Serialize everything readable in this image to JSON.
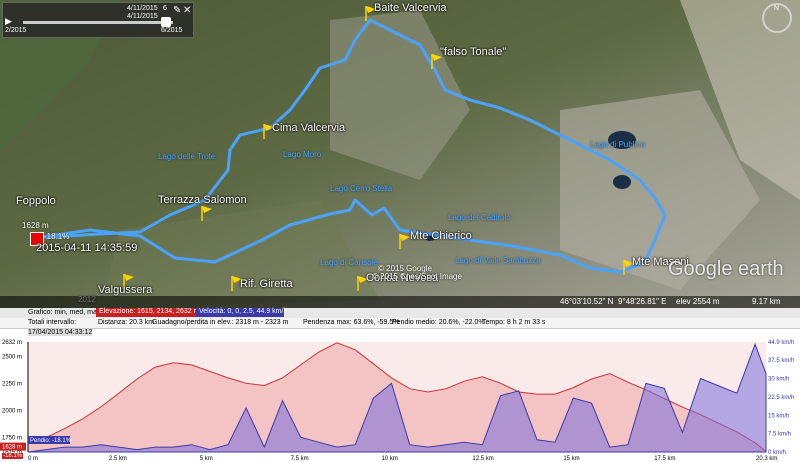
{
  "app": {
    "name": "Google Earth"
  },
  "timebar": {
    "start": "4/11/2015",
    "end": "4/11/2015",
    "end_short": "6",
    "left": "2/2015",
    "right": "6/2015"
  },
  "places": [
    {
      "name": "Baite Valcervia"
    },
    {
      "name": "\"falso Tonale\""
    },
    {
      "name": "Cima Valcervia"
    },
    {
      "name": "Terrazza Salomon"
    },
    {
      "name": "Foppolo"
    },
    {
      "name": "Mte Chierico"
    },
    {
      "name": "Mte Masoni"
    },
    {
      "name": "Valgussera"
    },
    {
      "name": "Rif. Giretta"
    },
    {
      "name": "Conca Nevosa"
    }
  ],
  "lakes": [
    "Lago delle Trote",
    "Lago Moro",
    "Lago di Publino",
    "Lago Cerro Stella",
    "Lago del Cadirolo",
    "Lago di Valle Sambuzza",
    "Lago di Carisole"
  ],
  "marker": {
    "elev": "1628 m",
    "grade": "-18.1%",
    "time": "2015-04-11 14:35:59"
  },
  "copyright": {
    "line1": "© 2015 Google",
    "line2": "© 2015 Cnes/Spot Image"
  },
  "watermark": {
    "year": "2012",
    "text": "Google earth"
  },
  "status": {
    "coords": "46°03'10.52\" N",
    "lon": "9°48'26.81\" E",
    "elev": "elev  2554 m",
    "eye": "9.17 km"
  },
  "profile": {
    "row1_label": "Grafico: min, med, max",
    "elev_label": "Elevazione: 1615, 2134, 2632 m",
    "speed_label": "Velocità: 0, 0, 2.5, 44.9 km/h",
    "row2_label": "Totali intervallo:",
    "dist": "Distanza: 20.3 km",
    "gain": "Guadagno/perdita in elev.: 2318 m - 2323 m",
    "slope": "Pendenza max: 63.6%, -59.5%",
    "slope_avg": "Pendio medio: 20.6%, -22.0%",
    "time": "Tempo: 8 h 2 m 33 s",
    "time_tag": "17/04/2015 04:33:12",
    "cursor_elev": "1628 m",
    "cursor_slope": "Pendio: -18.1%",
    "cursor_grade": "-18.1%",
    "y_left": [
      "2632 m",
      "2500 m",
      "2250 m",
      "2000 m",
      "1750 m",
      "1615 m"
    ],
    "y_right": [
      "44.9 km/h",
      "37.5 km/h",
      "30 km/h",
      "22.5 km/h",
      "15 km/h",
      "7.5 km/h",
      "0 km/h"
    ],
    "x_ticks": [
      "0 m",
      "2.5 km",
      "5 km",
      "7.5 km",
      "10 km",
      "12.5 km",
      "15 km",
      "17.5 km",
      "20.3 km"
    ]
  },
  "chart_data": {
    "type": "area",
    "xlabel": "",
    "ylabel": "",
    "xlim": [
      0,
      20.3
    ],
    "series": [
      {
        "name": "Elevazione",
        "unit": "m",
        "color": "#cc3333",
        "x": [
          0,
          0.5,
          1,
          1.5,
          2,
          2.5,
          3,
          3.5,
          4,
          4.5,
          5,
          5.5,
          6,
          6.5,
          7,
          7.5,
          8,
          8.5,
          9,
          9.5,
          10,
          10.5,
          11,
          11.5,
          12,
          12.5,
          13,
          13.5,
          14,
          14.5,
          15,
          15.5,
          16,
          16.5,
          17,
          17.5,
          18,
          18.5,
          19,
          19.5,
          20,
          20.3
        ],
        "y": [
          1690,
          1750,
          1830,
          1920,
          2030,
          2160,
          2290,
          2400,
          2440,
          2420,
          2360,
          2300,
          2250,
          2230,
          2300,
          2420,
          2540,
          2625,
          2560,
          2430,
          2300,
          2200,
          2170,
          2200,
          2270,
          2310,
          2250,
          2170,
          2150,
          2150,
          2210,
          2290,
          2340,
          2260,
          2190,
          2110,
          2030,
          1960,
          1880,
          1800,
          1700,
          1620
        ]
      },
      {
        "name": "Velocità",
        "unit": "km/h",
        "color": "#3a3aa8",
        "x": [
          0,
          0.5,
          1,
          1.5,
          2,
          2.5,
          3,
          3.5,
          4,
          4.5,
          5,
          5.5,
          6,
          6.5,
          7,
          7.5,
          8,
          8.5,
          9,
          9.5,
          10,
          10.5,
          11,
          11.5,
          12,
          12.5,
          13,
          13.5,
          14,
          14.5,
          15,
          15.5,
          16,
          16.5,
          17,
          17.5,
          18,
          18.5,
          19,
          19.5,
          20,
          20.3
        ],
        "y": [
          0,
          1,
          2,
          2,
          3,
          2,
          1,
          2,
          2,
          3,
          1,
          3,
          18,
          2,
          21,
          6,
          4,
          2,
          3,
          22,
          28,
          3,
          2,
          3,
          4,
          3,
          23,
          25,
          5,
          4,
          22,
          20,
          2,
          3,
          28,
          26,
          8,
          30,
          27,
          24,
          44,
          32
        ]
      }
    ],
    "ylim_left": [
      1615,
      2632
    ],
    "ylim_right": [
      0,
      44.9
    ],
    "grid": true,
    "legend": "top-left"
  }
}
